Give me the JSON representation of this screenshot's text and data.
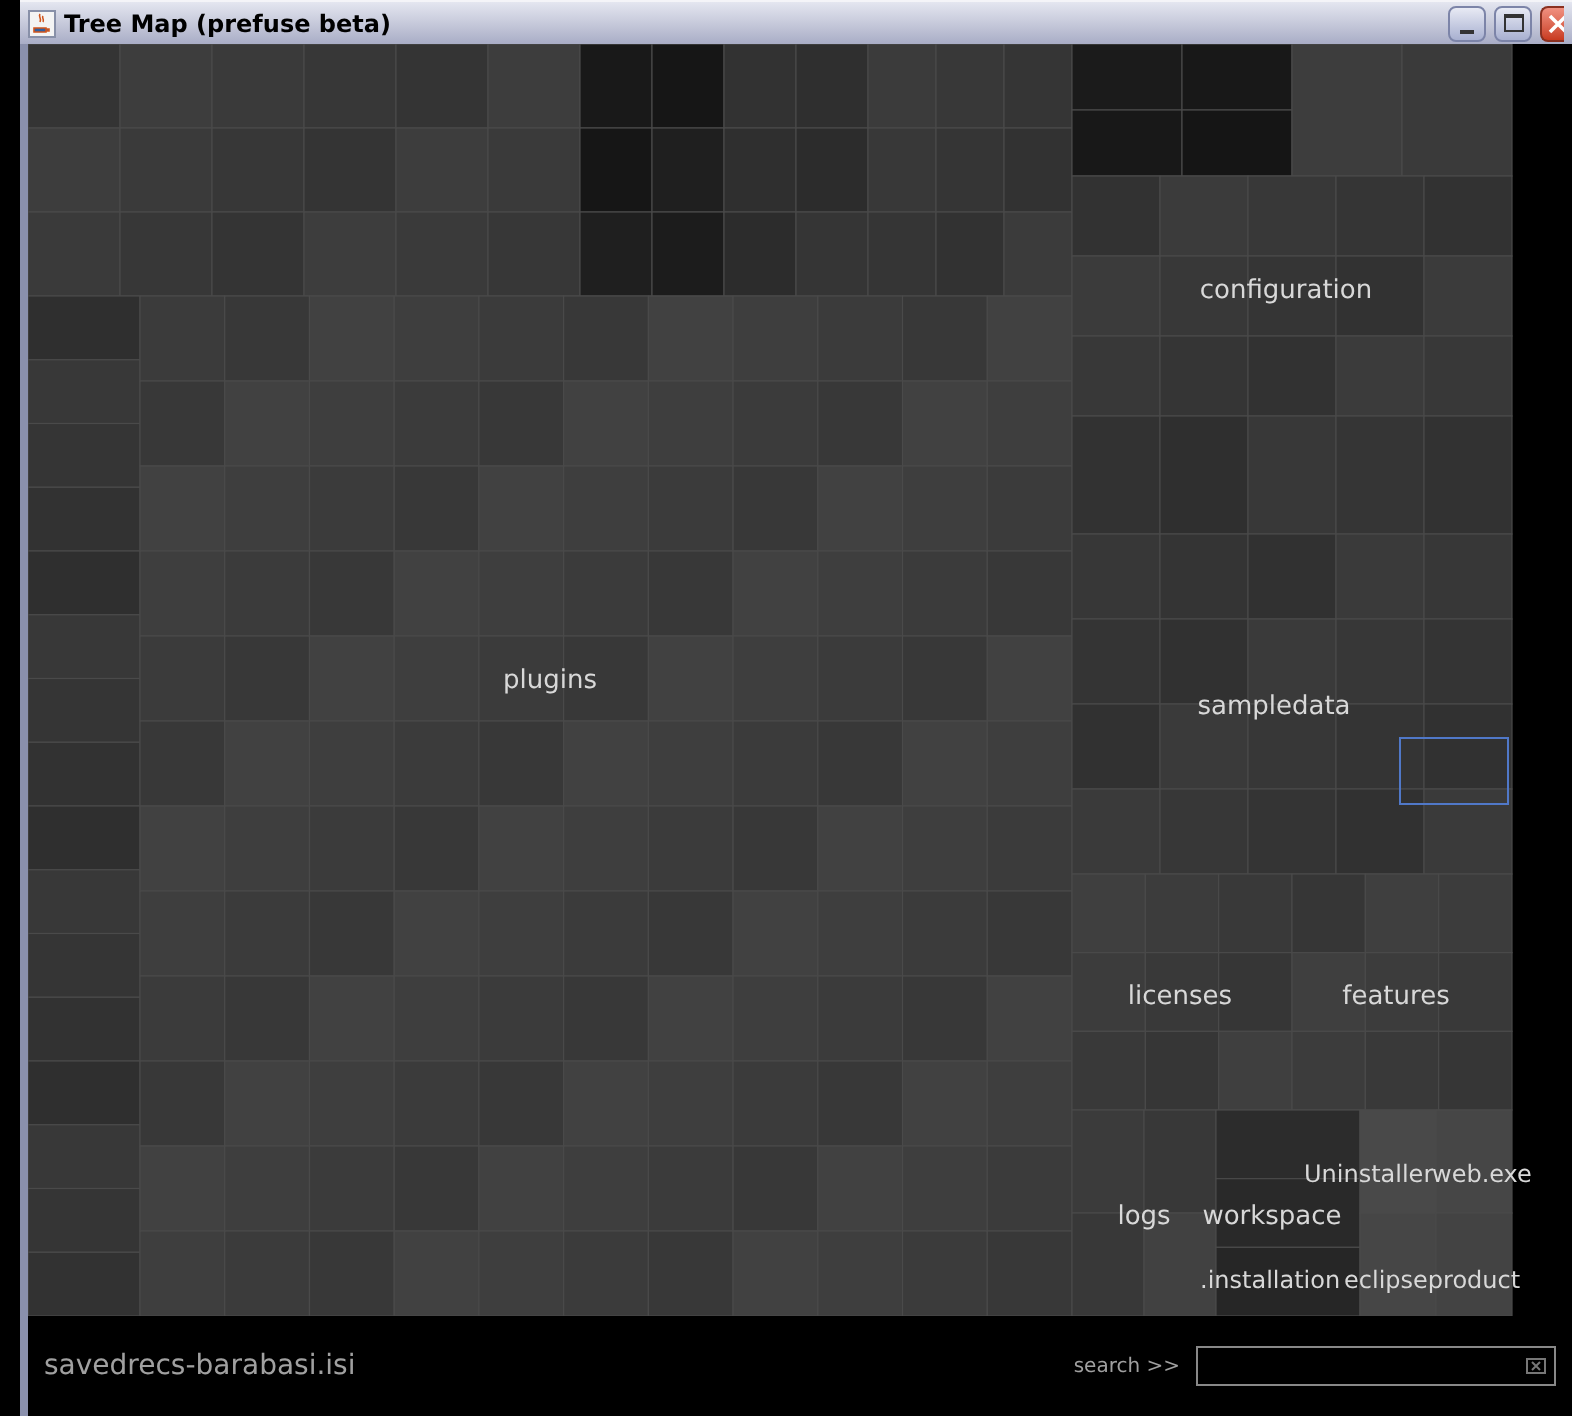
{
  "window": {
    "title": "Tree Map (prefuse beta)"
  },
  "treemap": {
    "labels": [
      "configuration",
      "plugins",
      "sampledata",
      "licenses",
      "features",
      "logs",
      "workspace",
      "Uninstaller",
      "web.exe",
      ".installation",
      "eclipseproduct"
    ]
  },
  "status_bar": {
    "file": "savedrecs-barabasi.isi",
    "search_label": "search >>"
  }
}
